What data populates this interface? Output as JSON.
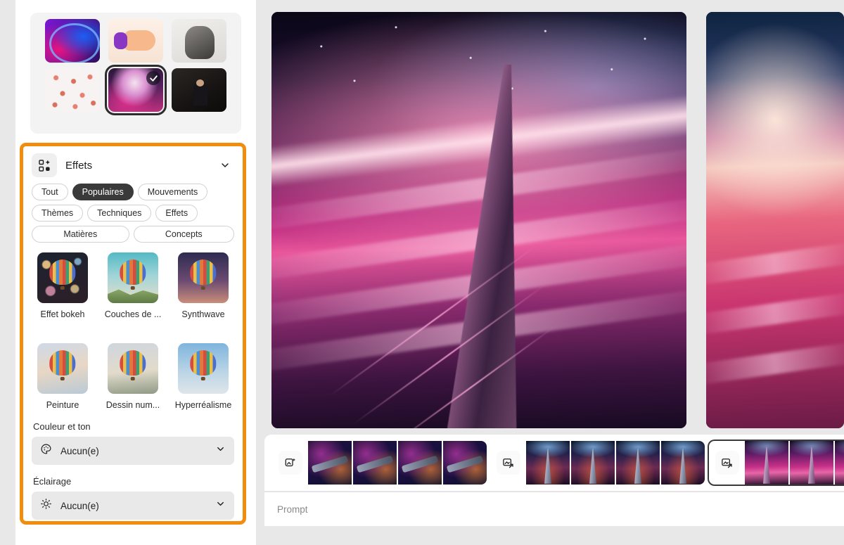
{
  "style_picker": {
    "name": "style-thumbnail-grid",
    "thumbs": [
      {
        "name": "neon-figure",
        "art": "t-neon",
        "selected": false
      },
      {
        "name": "cartoon-hand",
        "art": "t-hand",
        "selected": false
      },
      {
        "name": "pencil-portrait",
        "art": "t-sketch",
        "selected": false
      },
      {
        "name": "hand-pattern",
        "art": "t-pattern",
        "selected": false
      },
      {
        "name": "pink-clouds",
        "art": "t-cloud",
        "selected": true
      },
      {
        "name": "cinematic-person",
        "art": "t-person",
        "selected": false
      }
    ]
  },
  "effects_panel": {
    "title": "Effets",
    "icon": "effects-grid-icon",
    "collapse_icon": "chevron-down-icon",
    "chips": [
      {
        "label": "Tout",
        "active": false
      },
      {
        "label": "Populaires",
        "active": true
      },
      {
        "label": "Mouvements",
        "active": false
      },
      {
        "label": "Thèmes",
        "active": false
      },
      {
        "label": "Techniques",
        "active": false
      },
      {
        "label": "Effets",
        "active": false
      },
      {
        "label": "Matières",
        "active": false
      },
      {
        "label": "Concepts",
        "active": false
      }
    ],
    "effects": [
      {
        "label": "Effet bokeh",
        "art": "sky-bokeh"
      },
      {
        "label": "Couches de ...",
        "art": "sky-flat"
      },
      {
        "label": "Synthwave",
        "art": "sky-synth"
      },
      {
        "label": "Peinture",
        "art": "sky-paint"
      },
      {
        "label": "Dessin num...",
        "art": "sky-draw"
      },
      {
        "label": "Hyperréalisme",
        "art": "sky-hyper"
      }
    ],
    "sections": [
      {
        "label": "Couleur et ton",
        "value": "Aucun(e)",
        "icon": "palette-icon"
      },
      {
        "label": "Éclairage",
        "value": "Aucun(e)",
        "icon": "sun-icon"
      }
    ]
  },
  "canvas": {
    "main_image": {
      "name": "generated-image-main",
      "alt": "Skyscraper from above with pink atmosphere"
    },
    "side_image": {
      "name": "generated-image-secondary",
      "alt": "Pink clouds above horizon"
    }
  },
  "filmstrip": {
    "groups": [
      {
        "name": "generation-group-spaceships",
        "button_icon": "text-to-image-icon",
        "active": false,
        "art": "sc-ship",
        "count": 4
      },
      {
        "name": "generation-group-towers",
        "button_icon": "image-reference-icon",
        "active": false,
        "art": "sc-tower",
        "count": 4
      },
      {
        "name": "generation-group-pink-towers",
        "button_icon": "image-reference-icon",
        "active": true,
        "art": "sc-pink",
        "count": 3
      }
    ]
  },
  "prompt": {
    "placeholder": "Prompt",
    "value": ""
  },
  "colors": {
    "highlight": "#F28C0C",
    "chip_active_bg": "#3a3a3a",
    "panel_bg": "#ffffff",
    "app_bg": "#e8e8e8",
    "dropdown_bg": "#e9e9e9"
  }
}
